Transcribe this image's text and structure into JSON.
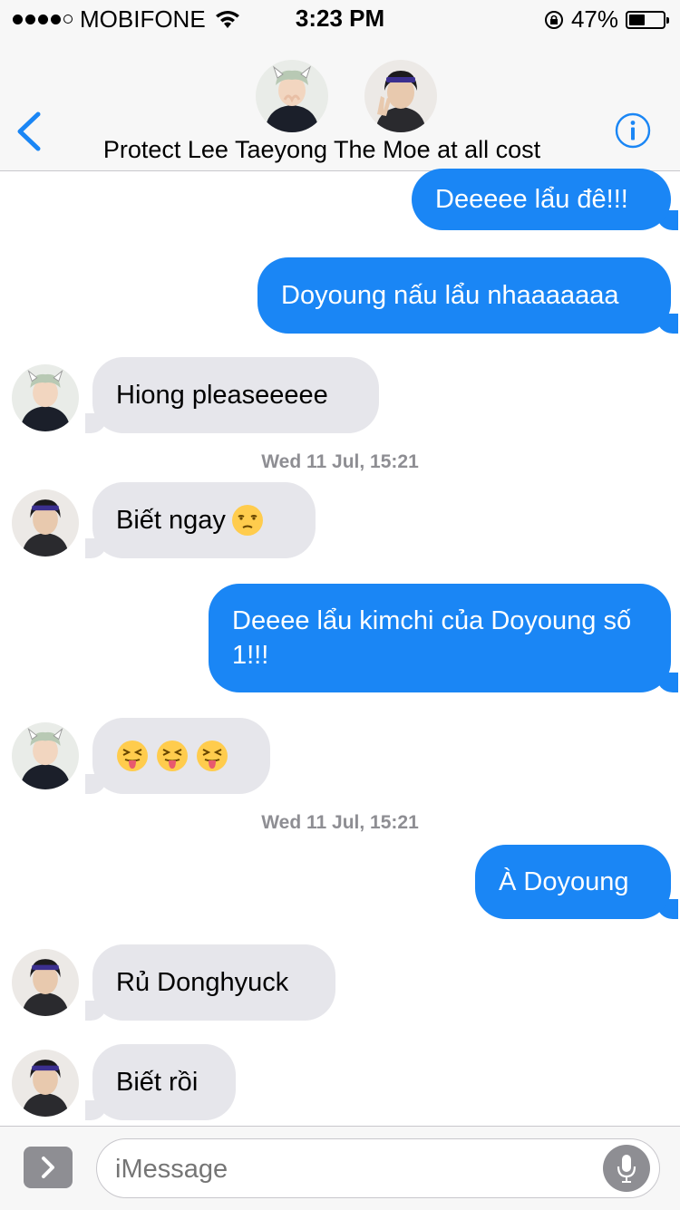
{
  "status_bar": {
    "carrier": "MOBIFONE",
    "time": "3:23 PM",
    "battery_text": "47%",
    "battery_level": 0.47
  },
  "header": {
    "title": "Protect Lee Taeyong The Moe at all cost"
  },
  "messages": [
    {
      "direction": "out",
      "text": "Deeeee lẩu đê!!!"
    },
    {
      "direction": "out",
      "text": "Doyoung nấu lẩu nhaaaaaaa"
    },
    {
      "direction": "in",
      "sender": "taeyong",
      "text": "Hiong pleaseeeee"
    },
    {
      "type": "timestamp",
      "text": "Wed 11 Jul, 15:21"
    },
    {
      "direction": "in",
      "sender": "jaehyun",
      "text": "Biết ngay",
      "emoji": "unamused-face"
    },
    {
      "direction": "out",
      "text": "Deeee lẩu kimchi của Doyoung số 1!!!"
    },
    {
      "direction": "in",
      "sender": "taeyong",
      "emojis": [
        "squinting-tongue-face",
        "squinting-tongue-face",
        "squinting-tongue-face"
      ]
    },
    {
      "type": "timestamp",
      "text": "Wed 11 Jul, 15:21"
    },
    {
      "direction": "out",
      "text": "À Doyoung"
    },
    {
      "direction": "in",
      "sender": "jaehyun",
      "text": "Rủ Donghyuck"
    },
    {
      "direction": "in",
      "sender": "jaehyun",
      "text": "Biết rồi"
    }
  ],
  "input": {
    "placeholder": "iMessage"
  },
  "colors": {
    "outgoing_bubble": "#1a86f5",
    "incoming_bubble": "#e6e6eb",
    "ios_blue": "#1a86f5"
  }
}
